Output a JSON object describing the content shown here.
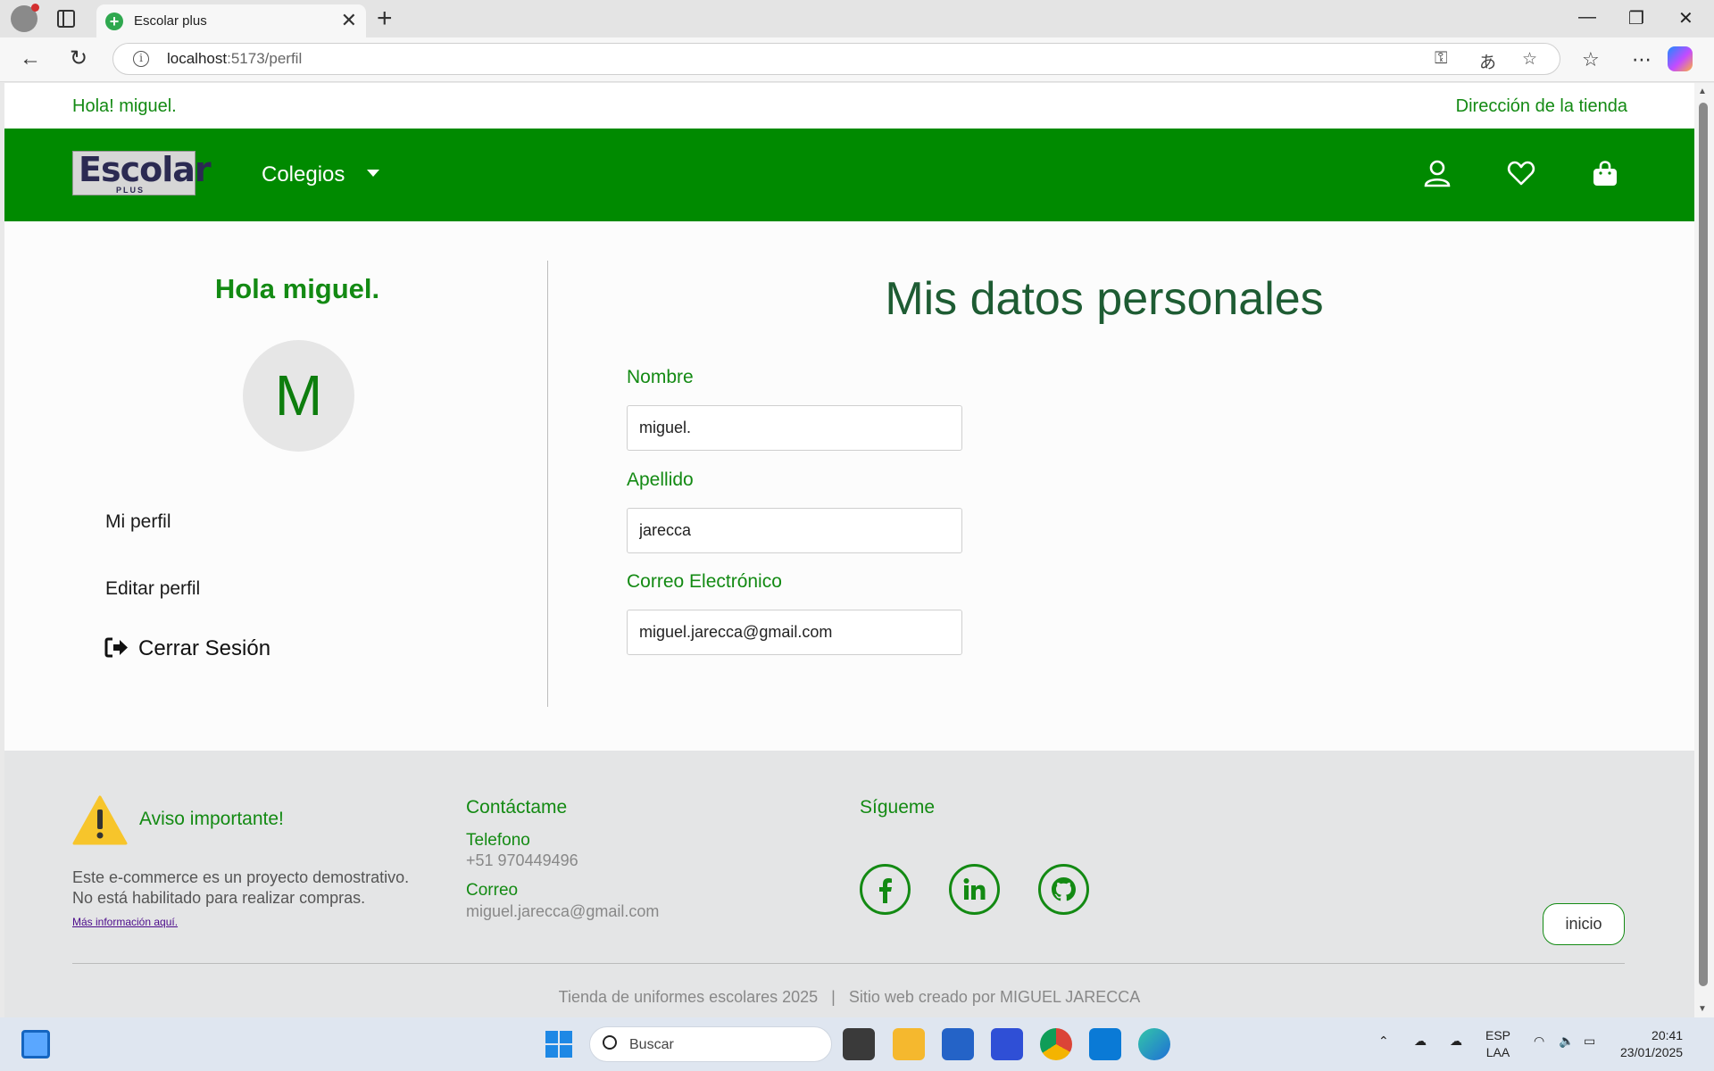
{
  "browser": {
    "tab_title": "Escolar plus",
    "url_host": "localhost",
    "url_path": ":5173/perfil"
  },
  "top_strip": {
    "greeting": "Hola! miguel.",
    "store_link": "Dirección de la tienda"
  },
  "navbar": {
    "logo_text": "Escolar",
    "logo_sub": "PLUS",
    "colegios": "Colegios",
    "icons": [
      "user-icon",
      "heart-icon",
      "shopping-bag-icon"
    ],
    "color": "#008a00"
  },
  "sidebar": {
    "hello": "Hola miguel.",
    "avatar_letter": "M",
    "links": [
      "Mi perfil",
      "Editar perfil"
    ],
    "logout": "Cerrar Sesión"
  },
  "main": {
    "title": "Mis datos personales",
    "fields": [
      {
        "label": "Nombre",
        "value": "miguel."
      },
      {
        "label": "Apellido",
        "value": "jarecca"
      },
      {
        "label": "Correo Electrónico",
        "value": "miguel.jarecca@gmail.com"
      }
    ]
  },
  "footer": {
    "aviso_title": "Aviso importante!",
    "aviso_line1": "Este e-commerce es un proyecto demostrativo.",
    "aviso_line2": "No está habilitado para realizar compras.",
    "aviso_link": "Más información aquí.",
    "contact_title": "Contáctame",
    "phone_label": "Telefono",
    "phone_value": "+51 970449496",
    "email_label": "Correo",
    "email_value": "miguel.jarecca@gmail.com",
    "follow_title": "Sígueme",
    "social": [
      "facebook-icon",
      "linkedin-icon",
      "github-icon"
    ],
    "inicio": "inicio",
    "copyright": "Tienda de uniformes escolares 2025   |   Sitio web creado por MIGUEL JARECCA"
  },
  "taskbar": {
    "search_placeholder": "Buscar",
    "lang_1": "ESP",
    "lang_2": "LAA",
    "time": "20:41",
    "date": "23/01/2025"
  }
}
